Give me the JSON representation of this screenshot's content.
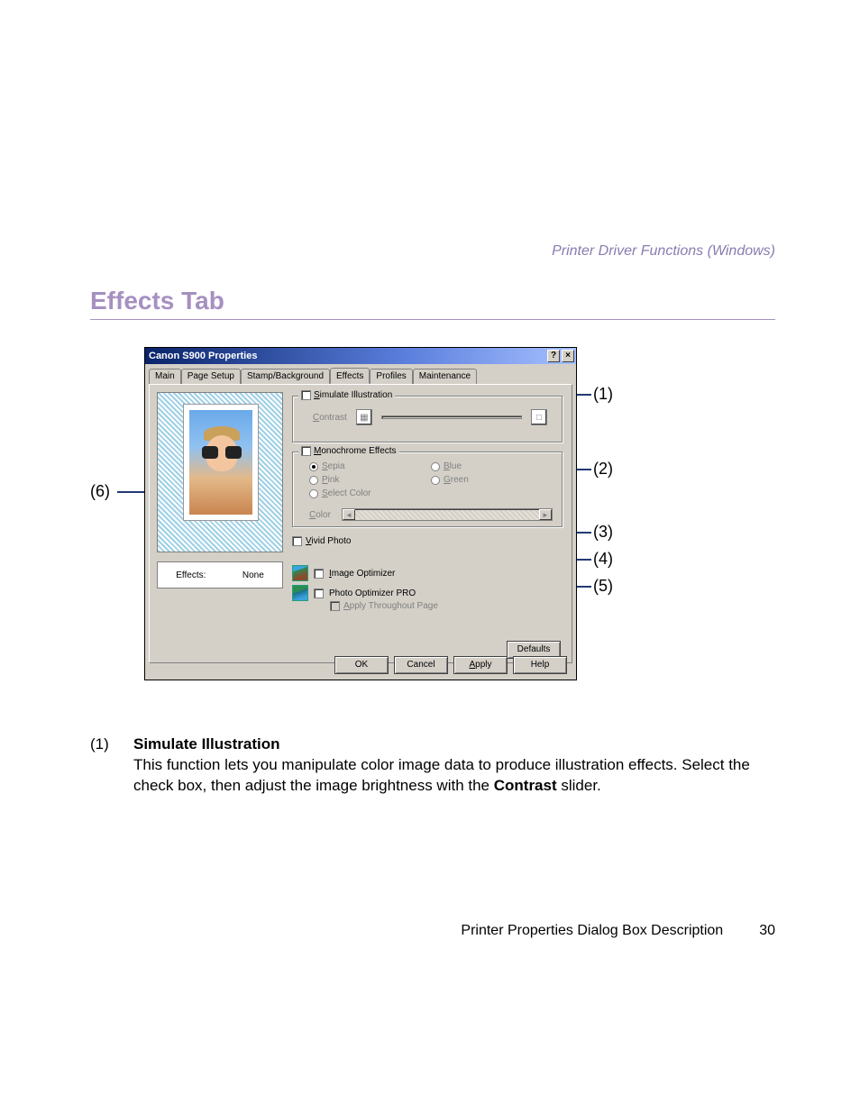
{
  "header": {
    "section_label": "Printer Driver Functions (Windows)"
  },
  "title": "Effects Tab",
  "dialog": {
    "window_title": "Canon S900 Properties",
    "help_glyph": "?",
    "close_glyph": "×",
    "tabs": {
      "main": "Main",
      "page_setup": "Page Setup",
      "stamp_background": "Stamp/Background",
      "effects": "Effects",
      "profiles": "Profiles",
      "maintenance": "Maintenance"
    },
    "preview": {
      "effects_label": "Effects:",
      "effects_value": "None"
    },
    "simulate": {
      "legend_prefix": "S",
      "legend_rest": "imulate Illustration",
      "contrast_prefix": "C",
      "contrast_rest": "ontrast",
      "low_glyph": "▦",
      "high_glyph": "□"
    },
    "mono": {
      "legend_prefix": "M",
      "legend_rest": "onochrome Effects",
      "sepia_prefix": "S",
      "sepia_rest": "epia",
      "blue_prefix": "B",
      "blue_rest": "lue",
      "pink_prefix": "P",
      "pink_rest": "ink",
      "green_prefix": "G",
      "green_rest": "reen",
      "select_prefix": "S",
      "select_rest": "elect Color",
      "color_prefix": "C",
      "color_rest": "olor",
      "arr_l": "◄",
      "arr_r": "►"
    },
    "vivid": {
      "prefix": "V",
      "rest": "ivid Photo"
    },
    "image_opt": {
      "prefix": "I",
      "rest": "mage Optimizer"
    },
    "photo_opt": {
      "label": "Photo Optimizer PRO"
    },
    "apply_throughout": {
      "prefix": "A",
      "rest": "pply Throughout Page"
    },
    "defaults_btn": "Defaults",
    "buttons": {
      "ok": "OK",
      "cancel": "Cancel",
      "apply_prefix": "A",
      "apply_rest": "pply",
      "help": "Help"
    }
  },
  "callouts": {
    "c1": "(1)",
    "c2": "(2)",
    "c3": "(3)",
    "c4": "(4)",
    "c5": "(5)",
    "c6": "(6)"
  },
  "body": {
    "num": "(1)",
    "heading": "Simulate Illustration",
    "para_a": "This function lets you manipulate color image data to produce illustration effects. Select the check box, then adjust the image brightness with the ",
    "bold": "Contrast",
    "para_b": " slider."
  },
  "footer": {
    "text": "Printer Properties Dialog Box Description",
    "page": "30"
  }
}
